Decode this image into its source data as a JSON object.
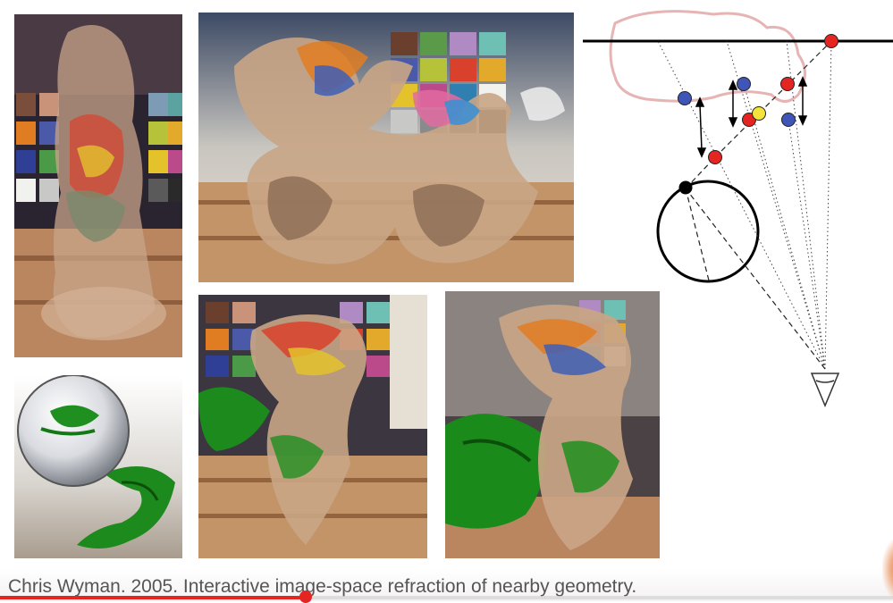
{
  "caption": "Chris Wyman. 2005. Interactive image-space refraction of nearby geometry.",
  "video": {
    "progress": 0.342
  },
  "colors": {
    "accent": "#e52521"
  },
  "icons": {
    "diagram_eye": "eye-icon"
  }
}
